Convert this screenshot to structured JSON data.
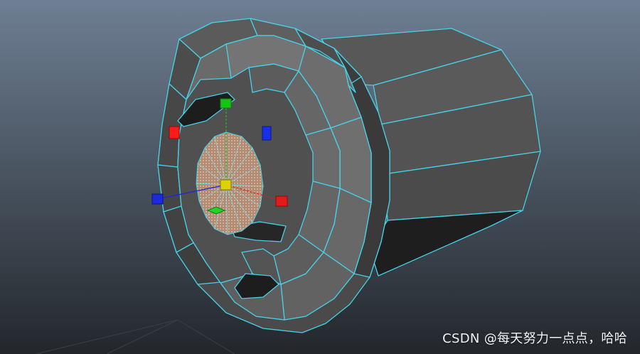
{
  "viewport": {
    "background_top": "#6e7f93",
    "background_bottom": "#23272c",
    "mesh_fill_light": "#6c6c6c",
    "mesh_fill_mid": "#585858",
    "mesh_fill_dark": "#474747",
    "mesh_fill_shadow": "#1d1d1d",
    "wireframe_color": "#47d1e8",
    "selected_face_color": "#c9a08a",
    "grid_color": "#3a3f46"
  },
  "manipulator": {
    "center_icon": "yellow-center-handle-icon",
    "x_axis_color": "#e11b1b",
    "y_axis_color": "#18c318",
    "z_axis_color": "#1b2bd9",
    "center_color": "#e0d200"
  },
  "watermark": {
    "text": "CSDN @每天努力一点点，哈哈"
  }
}
